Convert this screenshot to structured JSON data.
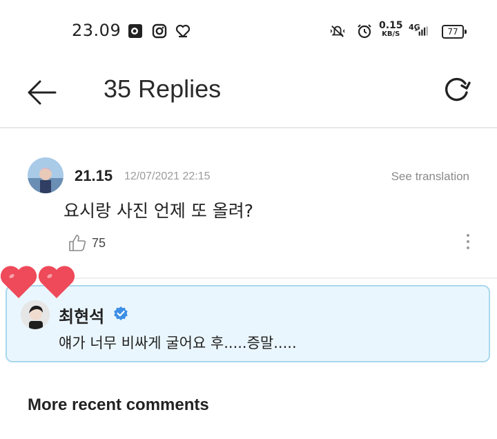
{
  "status_bar": {
    "time": "23.09",
    "net_speed_value": "0.15",
    "net_speed_unit": "KB/S",
    "network": "4G",
    "battery": "77",
    "icons": [
      "gallery-icon",
      "instagram-icon",
      "heart-outline-icon",
      "mute-icon",
      "alarm-icon",
      "signal-icon"
    ]
  },
  "header": {
    "title": "35 Replies",
    "back_icon": "back-arrow-icon",
    "refresh_icon": "refresh-icon"
  },
  "comment": {
    "username": "21.15",
    "timestamp": "12/07/2021 22:15",
    "see_translation": "See translation",
    "text": "요시랑 사진 언제 또 올려?",
    "likes": "75"
  },
  "reply": {
    "username": "최현석",
    "verified": true,
    "text": "얘가 너무 비싸게 굴어요 후.....증말.....",
    "highlight_color": "#eaf6fd",
    "border_color": "#a8d8ef"
  },
  "section": {
    "title": "More recent comments"
  },
  "colors": {
    "heart": "#ee4a5a",
    "verified_badge": "#3d8fe6"
  }
}
